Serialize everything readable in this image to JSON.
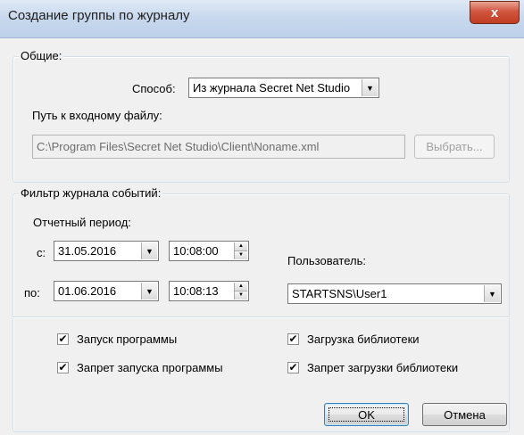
{
  "window": {
    "title": "Создание группы по журналу",
    "close_glyph": "x"
  },
  "general": {
    "group_label": "Общие:",
    "method_label": "Способ:",
    "method_value": "Из журнала Secret Net Studio",
    "path_label": "Путь к входному файлу:",
    "path_value": "C:\\Program Files\\Secret Net Studio\\Client\\Noname.xml",
    "browse_label": "Выбрать..."
  },
  "filter": {
    "group_label": "Фильтр журнала событий:",
    "period_label": "Отчетный период:",
    "from_label": "с:",
    "from_date": "31.05.2016",
    "from_time": "10:08:00",
    "to_label": "по:",
    "to_date": "01.06.2016",
    "to_time": "10:08:13",
    "user_label": "Пользователь:",
    "user_value": "STARTSNS\\User1"
  },
  "options": [
    {
      "label": "Запуск программы",
      "checked": true
    },
    {
      "label": "Запрет запуска программы",
      "checked": true
    },
    {
      "label": "Загрузка библиотеки",
      "checked": true
    },
    {
      "label": "Запрет загрузки библиотеки",
      "checked": true
    }
  ],
  "buttons": {
    "ok": "OK",
    "cancel": "Отмена"
  },
  "glyphs": {
    "dropdown": "▼",
    "spin_up": "▲",
    "spin_down": "▼",
    "check": "✔"
  }
}
